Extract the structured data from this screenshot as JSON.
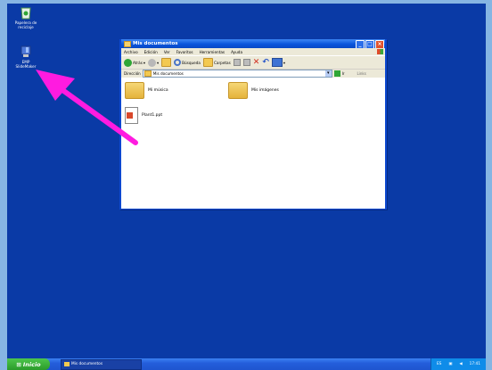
{
  "desktop": {
    "icons": [
      {
        "label_line1": "Papelera de",
        "label_line2": "reciclaje",
        "icon": "recycle-bin-icon"
      },
      {
        "label_line1": "EMP",
        "label_line2": "SlideMaker",
        "icon": "emp-slidemaker-icon"
      }
    ]
  },
  "window": {
    "title": "Mis documentos",
    "menu": [
      "Archivo",
      "Edición",
      "Ver",
      "Favoritos",
      "Herramientas",
      "Ayuda"
    ],
    "toolbar": {
      "back_label": "Atrás",
      "search_label": "Búsqueda",
      "folders_label": "Carpetas"
    },
    "address": {
      "label": "Dirección",
      "value": "Mis documentos",
      "go_label": "Ir",
      "links_label": "Links"
    },
    "items": [
      {
        "name": "Mi música",
        "type": "folder"
      },
      {
        "name": "Mis imágenes",
        "type": "folder"
      },
      {
        "name": "Plant1.ppt",
        "type": "ppt-file"
      }
    ]
  },
  "taskbar": {
    "start_label": "Inicio",
    "task_label": "Mis documentos",
    "tray": {
      "lang": "ES",
      "time": "17:41"
    }
  },
  "colors": {
    "desktop": "#0a3aa6",
    "arrow": "#ff1be0",
    "taskbar": "#245edb",
    "start": "#2a9b2a"
  }
}
